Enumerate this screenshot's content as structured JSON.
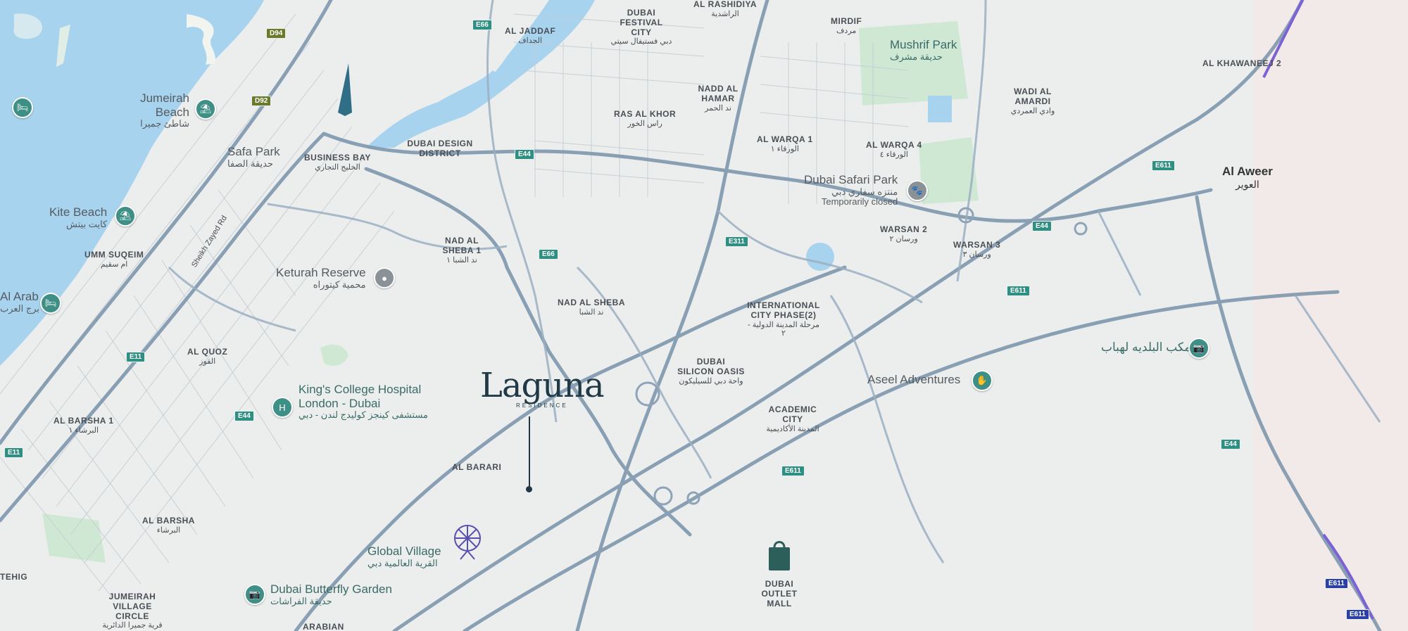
{
  "map": {
    "colors": {
      "water": "#a8d3ee",
      "land": "#eceeed",
      "park": "#cfe8d4",
      "road": "#8fa3b8",
      "road_main": "#7c93ab",
      "poi_teal": "#3e8f86",
      "desert": "#f4ecea"
    },
    "logo": {
      "word": "Laguna",
      "sub": "RESIDENCE"
    },
    "areas": {
      "al_jaddaf": {
        "en": "AL JADDAF",
        "ar": "الجداف"
      },
      "dubai_festival_city": {
        "en": "DUBAI FESTIVAL CITY",
        "ar": "دبي فستيفال سيتي"
      },
      "al_rashidiya": {
        "en": "AL RASHIDIYA",
        "ar": "الراشدية"
      },
      "mirdif": {
        "en": "MIRDIF",
        "ar": "مردف"
      },
      "al_khawaneej_2": {
        "en": "AL KHAWANEEJ 2",
        "ar": ""
      },
      "nadd_al_hamar": {
        "en": "NADD AL HAMAR",
        "ar": "ند الحمر"
      },
      "ras_al_khor": {
        "en": "RAS AL KHOR",
        "ar": "راس الخور"
      },
      "wadi_al_amardi": {
        "en": "WADI AL AMARDI",
        "ar": "وادي العمردي"
      },
      "dubai_design_district": {
        "en": "DUBAI DESIGN DISTRICT",
        "ar": ""
      },
      "business_bay": {
        "en": "BUSINESS BAY",
        "ar": "الخليج التجاري"
      },
      "al_warqa_1": {
        "en": "AL WARQA 1",
        "ar": "الورقاء ١"
      },
      "al_warqa_4": {
        "en": "AL WARQA 4",
        "ar": "الورقاء ٤"
      },
      "nad_al_sheba_1": {
        "en": "NAD AL SHEBA 1",
        "ar": "ند الشبا ١"
      },
      "warsan_2": {
        "en": "WARSAN 2",
        "ar": "ورسان ٢"
      },
      "warsan_3": {
        "en": "WARSAN 3",
        "ar": "ورسان ٣"
      },
      "umm_suqeim": {
        "en": "UMM SUQEIM",
        "ar": "ام سقيم"
      },
      "nad_al_sheba": {
        "en": "NAD AL SHEBA",
        "ar": "ند الشبا"
      },
      "international_city": {
        "en": "INTERNATIONAL CITY PHASE(2)",
        "ar": "مرحلة المدينة الدولية - ٢"
      },
      "al_quoz": {
        "en": "AL QUOZ",
        "ar": "القوز"
      },
      "dubai_silicon_oasis": {
        "en": "DUBAI SILICON OASIS",
        "ar": "واحة دبي للسيليكون"
      },
      "academic_city": {
        "en": "ACADEMIC CITY",
        "ar": "المدينة الأكاديمية"
      },
      "al_barsha_1": {
        "en": "AL BARSHA 1",
        "ar": "البرشاء ١"
      },
      "al_barari": {
        "en": "AL BARARI",
        "ar": ""
      },
      "al_barsha": {
        "en": "AL BARSHA",
        "ar": "البرشاء"
      },
      "jumeirah_village_circle": {
        "en": "JUMEIRAH VILLAGE CIRCLE",
        "ar": "قرية جميرا الدائرية"
      },
      "arabian": {
        "en": "ARABIAN",
        "ar": ""
      },
      "dubai_outlet_mall": {
        "en": "DUBAI OUTLET MALL",
        "ar": ""
      },
      "tehig": {
        "en": "TEHIG",
        "ar": ""
      }
    },
    "places": {
      "al_aweer": {
        "en": "Al Aweer",
        "ar": "العوير"
      },
      "mushrif_park": {
        "en": "Mushrif Park",
        "ar": "حديقة مشرف"
      },
      "jumeirah_beach": {
        "en": "Jumeirah Beach",
        "ar": "شاطئ جميرا"
      },
      "safa_park": {
        "en": "Safa Park",
        "ar": "حديقة الصفا"
      },
      "dubai_safari_park": {
        "en": "Dubai Safari Park",
        "ar": "منتزه سفاري دبي",
        "status": "Temporarily closed"
      },
      "kite_beach": {
        "en": "Kite Beach",
        "ar": "كايت بيتش"
      },
      "keturah_reserve": {
        "en": "Keturah Reserve",
        "ar": "محمية كيتوراه"
      },
      "al_arab": {
        "en": "Al Arab",
        "ar": "برج العرب"
      },
      "kings_college": {
        "en": "King's College Hospital London - Dubai",
        "line1": "King's College Hospital",
        "line2": "London - Dubai",
        "ar": "مستشفى كينجز كوليدج لندن - دبي"
      },
      "aseel_adventures": {
        "en": "Aseel Adventures"
      },
      "maktab_albaladia": {
        "ar": "مكب البلديه لهباب"
      },
      "global_village": {
        "en": "Global Village",
        "ar": "القرية العالمية دبي"
      },
      "dubai_butterfly_garden": {
        "en": "Dubai Butterfly Garden",
        "ar": "حديقة الفراشات"
      }
    },
    "roads": {
      "sheikh_zayed": "Sheikh Zayed Rd",
      "shields": {
        "d94": "D94",
        "d92": "D92",
        "e66_a": "E66",
        "e66_b": "E66",
        "e44_a": "E44",
        "e44_b": "E44",
        "e44_c": "E44",
        "e44_d": "E44",
        "e611_a": "E611",
        "e611_b": "E611",
        "e611_c": "E611",
        "e311": "E311",
        "e11_a": "E11",
        "e11_b": "E11",
        "e611_d": "E611",
        "e611_e": "E611"
      }
    }
  }
}
